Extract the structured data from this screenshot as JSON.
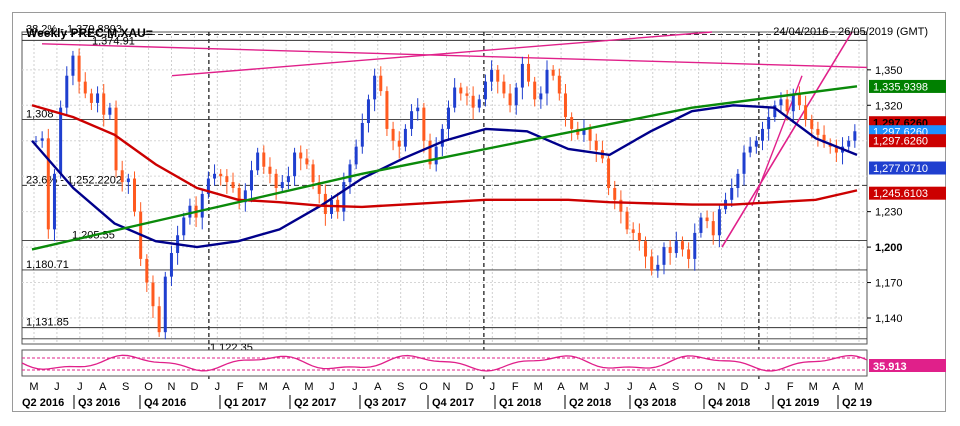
{
  "chart_data": {
    "type": "candlestick",
    "title": "Weekly PREC.M.XAU=",
    "date_range": "24/04/2016 - 26/05/2019 (GMT)",
    "y_axis": {
      "ticks": [
        1140,
        1170,
        1200,
        1230,
        1260,
        1290,
        1320,
        1350
      ],
      "tick_labels": [
        "1,140",
        "1,170",
        "1,200",
        "1,230",
        "",
        "",
        "1,320",
        "1,350"
      ],
      "ylim": [
        1118,
        1382
      ]
    },
    "months": [
      "M",
      "J",
      "J",
      "A",
      "S",
      "O",
      "N",
      "D",
      "J",
      "F",
      "M",
      "A",
      "M",
      "J",
      "J",
      "A",
      "S",
      "O",
      "N",
      "D",
      "J",
      "F",
      "M",
      "A",
      "M",
      "J",
      "J",
      "A",
      "S",
      "O",
      "N",
      "D",
      "J",
      "F",
      "M",
      "A",
      "M"
    ],
    "quarters": [
      "Q2 2016",
      "Q3 2016",
      "Q4 2016",
      "Q1 2017",
      "Q2 2017",
      "Q3 2017",
      "Q4 2017",
      "Q1 2018",
      "Q2 2018",
      "Q3 2018",
      "Q4 2018",
      "Q1 2019",
      "Q2 19"
    ],
    "horizontal_levels": [
      {
        "label": "38.2% - 1,379.8893",
        "value": 1379.89
      },
      {
        "label": "1,374.91",
        "value": 1374.91
      },
      {
        "label": "1,308",
        "value": 1308
      },
      {
        "label": "23.6% - 1,252.2202",
        "value": 1252.22
      },
      {
        "label": "1,205.55",
        "value": 1205.55
      },
      {
        "label": "1,180.71",
        "value": 1180.71
      },
      {
        "label": "1,131.85",
        "value": 1131.85
      },
      {
        "label": "1,122.35",
        "value": 1122.35
      }
    ],
    "price_labels": [
      {
        "text": "1,335.9398",
        "value": 1335.94,
        "color": "#008000"
      },
      {
        "text": "1,297.6260",
        "value": 1297.63,
        "color": "#cc0000"
      },
      {
        "text": "1,297.6260",
        "value": 1297.63,
        "color": "#1e90ff"
      },
      {
        "text": "1,297.6260",
        "value": 1297.63,
        "color": "#cc0000"
      },
      {
        "text": "1,277.0710",
        "value": 1277.07,
        "color": "#1f3fcf"
      },
      {
        "text": "1,245.6103",
        "value": 1245.61,
        "color": "#cc0000"
      }
    ],
    "oscillator_value": "35.913",
    "series": [
      {
        "kind": "candles",
        "close": [
          1290,
          1292,
          1215,
          1262,
          1318,
          1345,
          1362,
          1340,
          1330,
          1322,
          1330,
          1312,
          1318,
          1265,
          1255,
          1258,
          1230,
          1190,
          1170,
          1150,
          1128,
          1175,
          1195,
          1210,
          1225,
          1235,
          1225,
          1245,
          1258,
          1262,
          1260,
          1255,
          1250,
          1238,
          1248,
          1265,
          1280,
          1268,
          1262,
          1250,
          1255,
          1260,
          1280,
          1275,
          1270,
          1255,
          1245,
          1228,
          1240,
          1230,
          1255,
          1270,
          1285,
          1305,
          1325,
          1345,
          1332,
          1300,
          1290,
          1285,
          1300,
          1315,
          1318,
          1290,
          1270,
          1285,
          1300,
          1318,
          1335,
          1330,
          1328,
          1318,
          1325,
          1340,
          1350,
          1340,
          1330,
          1320,
          1335,
          1355,
          1340,
          1325,
          1330,
          1350,
          1345,
          1330,
          1310,
          1300,
          1295,
          1300,
          1290,
          1282,
          1275,
          1250,
          1240,
          1230,
          1215,
          1212,
          1205,
          1192,
          1180,
          1185,
          1200,
          1195,
          1205,
          1198,
          1190,
          1212,
          1225,
          1222,
          1210,
          1232,
          1240,
          1250,
          1262,
          1280,
          1285,
          1290,
          1300,
          1310,
          1320,
          1325,
          1315,
          1330,
          1320,
          1308,
          1300,
          1295,
          1288,
          1285,
          1280,
          1285,
          1290,
          1298
        ]
      },
      {
        "name": "",
        "color": "#00008b",
        "values": [
          1290,
          1250,
          1220,
          1205,
          1200,
          1205,
          1215,
          1235,
          1258,
          1275,
          1290,
          1300,
          1298,
          1283,
          1278,
          1298,
          1315,
          1320,
          1318,
          1292,
          1278
        ]
      },
      {
        "name": "",
        "color": "#cc0000",
        "values": [
          1320,
          1310,
          1295,
          1270,
          1250,
          1240,
          1238,
          1235,
          1234,
          1236,
          1238,
          1240,
          1240,
          1240,
          1238,
          1237,
          1236,
          1236,
          1238,
          1240,
          1248
        ]
      },
      {
        "name": "",
        "color": "#0a8a0a",
        "values": [
          1198,
          1230,
          1262,
          1290,
          1318,
          1336
        ]
      }
    ]
  }
}
